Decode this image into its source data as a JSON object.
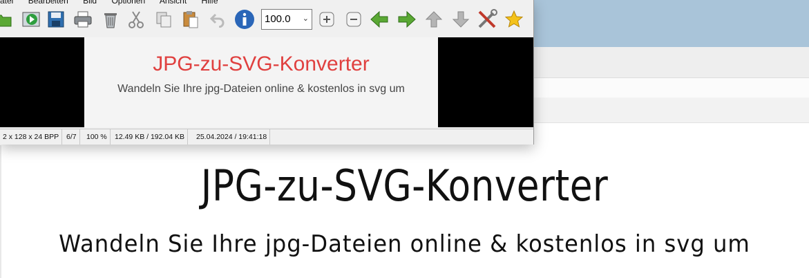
{
  "viewer": {
    "menu": [
      "atei",
      "Bearbeiten",
      "Bild",
      "Optionen",
      "Ansicht",
      "Hilfe"
    ],
    "zoom_value": "100.0",
    "thumbnail": {
      "title": "JPG-zu-SVG-Konverter",
      "subtitle": "Wandeln Sie Ihre jpg-Dateien online & kostenlos in svg um"
    },
    "status": {
      "dimensions": "2 x 128 x 24 BPP",
      "index": "6/7",
      "zoom": "100 %",
      "size": "12.49 KB / 192.04 KB",
      "datetime": "25.04.2024 / 19:41:18"
    }
  },
  "page": {
    "title": "JPG-zu-SVG-Konverter",
    "subtitle": "Wandeln Sie Ihre jpg-Dateien online & kostenlos in svg um"
  },
  "colors": {
    "accent_red": "#e0403f",
    "sky_band": "#a9c4d9"
  },
  "icons": [
    "open-folder-icon",
    "slideshow-icon",
    "save-icon",
    "print-icon",
    "delete-icon",
    "cut-icon",
    "copy-icon",
    "paste-icon",
    "undo-icon",
    "info-icon",
    "zoom-in-icon",
    "zoom-out-icon",
    "previous-arrow-icon",
    "next-arrow-icon",
    "up-arrow-icon",
    "down-arrow-icon",
    "settings-tools-icon",
    "favorite-star-icon"
  ]
}
